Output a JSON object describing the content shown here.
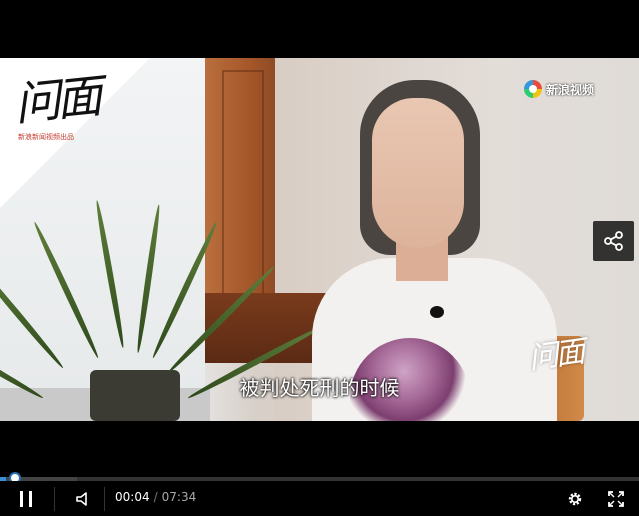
{
  "overlay": {
    "logo_text": "问面",
    "logo_sub": "新浪新闻视频出品",
    "brand": "新浪视频",
    "watermark": "问面",
    "subtitle": "被判处死刑的时候"
  },
  "player": {
    "current_time": "00:04",
    "duration": "07:34",
    "progress_fraction": 0.009,
    "buffered_fraction": 0.12,
    "play_state": "playing",
    "colors": {
      "progress": "#3a8fd9",
      "bar_bg": "#000000"
    },
    "icons": [
      "pause-icon",
      "volume-icon",
      "settings-gear-icon",
      "fullscreen-icon",
      "share-icon"
    ]
  }
}
